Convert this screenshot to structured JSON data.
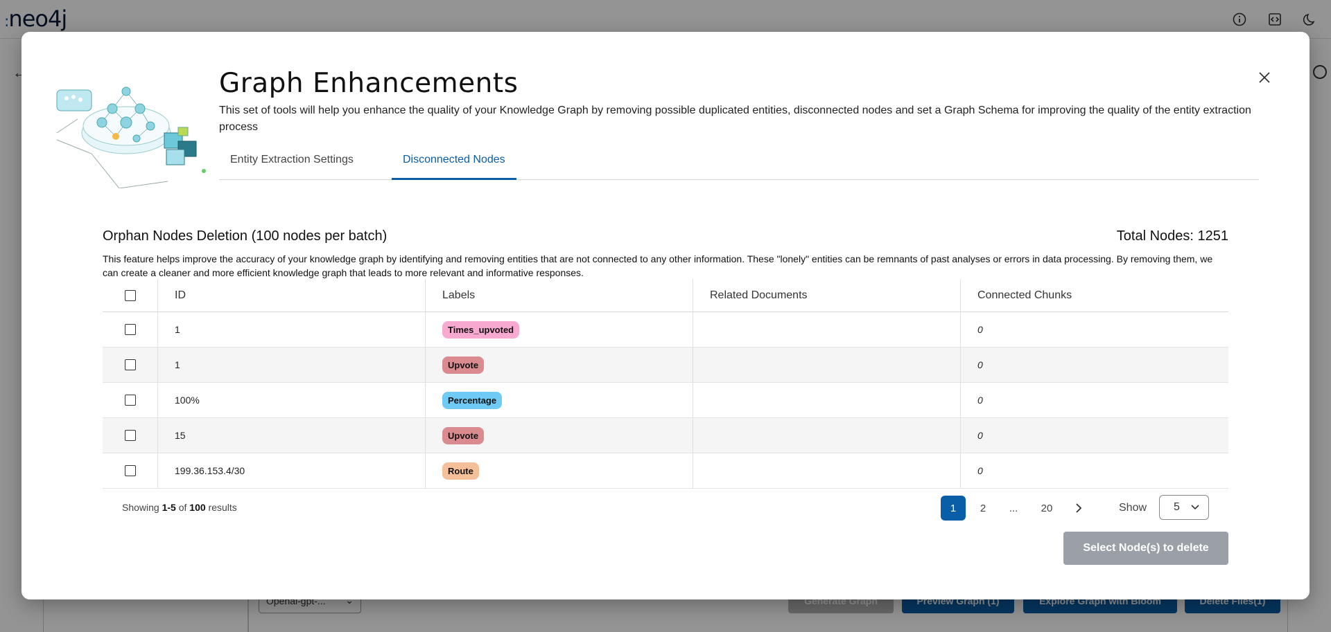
{
  "app": {
    "logo_text": "neo4j",
    "header_icons": [
      "info-icon",
      "code-icon",
      "moon-icon"
    ]
  },
  "background": {
    "model_select": "Openai-gpt-...",
    "buttons": {
      "generate": "Generate Graph",
      "preview": "Preview Graph (1)",
      "explore": "Explore Graph with Bloom",
      "delete_files": "Delete Files(1)"
    }
  },
  "modal": {
    "title": "Graph Enhancements",
    "subtitle": "This set of tools will help you enhance the quality of your Knowledge Graph by removing possible duplicated entities, disconnected nodes and set a Graph Schema for improving the quality of the entity extraction process",
    "tabs": [
      {
        "label": "Entity Extraction Settings",
        "active": false
      },
      {
        "label": "Disconnected Nodes",
        "active": true
      }
    ],
    "section_title": "Orphan Nodes Deletion (100 nodes per batch)",
    "total_nodes": "Total Nodes: 1251",
    "description": "This feature helps improve the accuracy of your knowledge graph by identifying and removing entities that are not connected to any other information. These \"lonely\" entities can be remnants of past analyses or errors in data processing. By removing them, we can create a cleaner and more efficient knowledge graph that leads to more relevant and informative responses.",
    "table": {
      "headers": {
        "id": "ID",
        "labels": "Labels",
        "related_documents": "Related Documents",
        "connected_chunks": "Connected Chunks"
      },
      "rows": [
        {
          "id": "1",
          "label": "Times_upvoted",
          "label_color": "#f8a9d0",
          "related_documents": "",
          "connected_chunks": "0"
        },
        {
          "id": "1",
          "label": "Upvote",
          "label_color": "#d98b8f",
          "related_documents": "",
          "connected_chunks": "0"
        },
        {
          "id": "100%",
          "label": "Percentage",
          "label_color": "#6fcbf5",
          "related_documents": "",
          "connected_chunks": "0"
        },
        {
          "id": "15",
          "label": "Upvote",
          "label_color": "#d98b8f",
          "related_documents": "",
          "connected_chunks": "0"
        },
        {
          "id": "199.36.153.4/30",
          "label": "Route",
          "label_color": "#f5bf9a",
          "related_documents": "",
          "connected_chunks": "0"
        }
      ]
    },
    "pagination": {
      "showing_prefix": "Showing",
      "range": "1-5",
      "of": "of",
      "total": "100",
      "suffix": "results",
      "pages": [
        "1",
        "2",
        "...",
        "20"
      ],
      "current_page": "1",
      "show_label": "Show",
      "page_size": "5"
    },
    "delete_button": "Select Node(s) to delete"
  }
}
